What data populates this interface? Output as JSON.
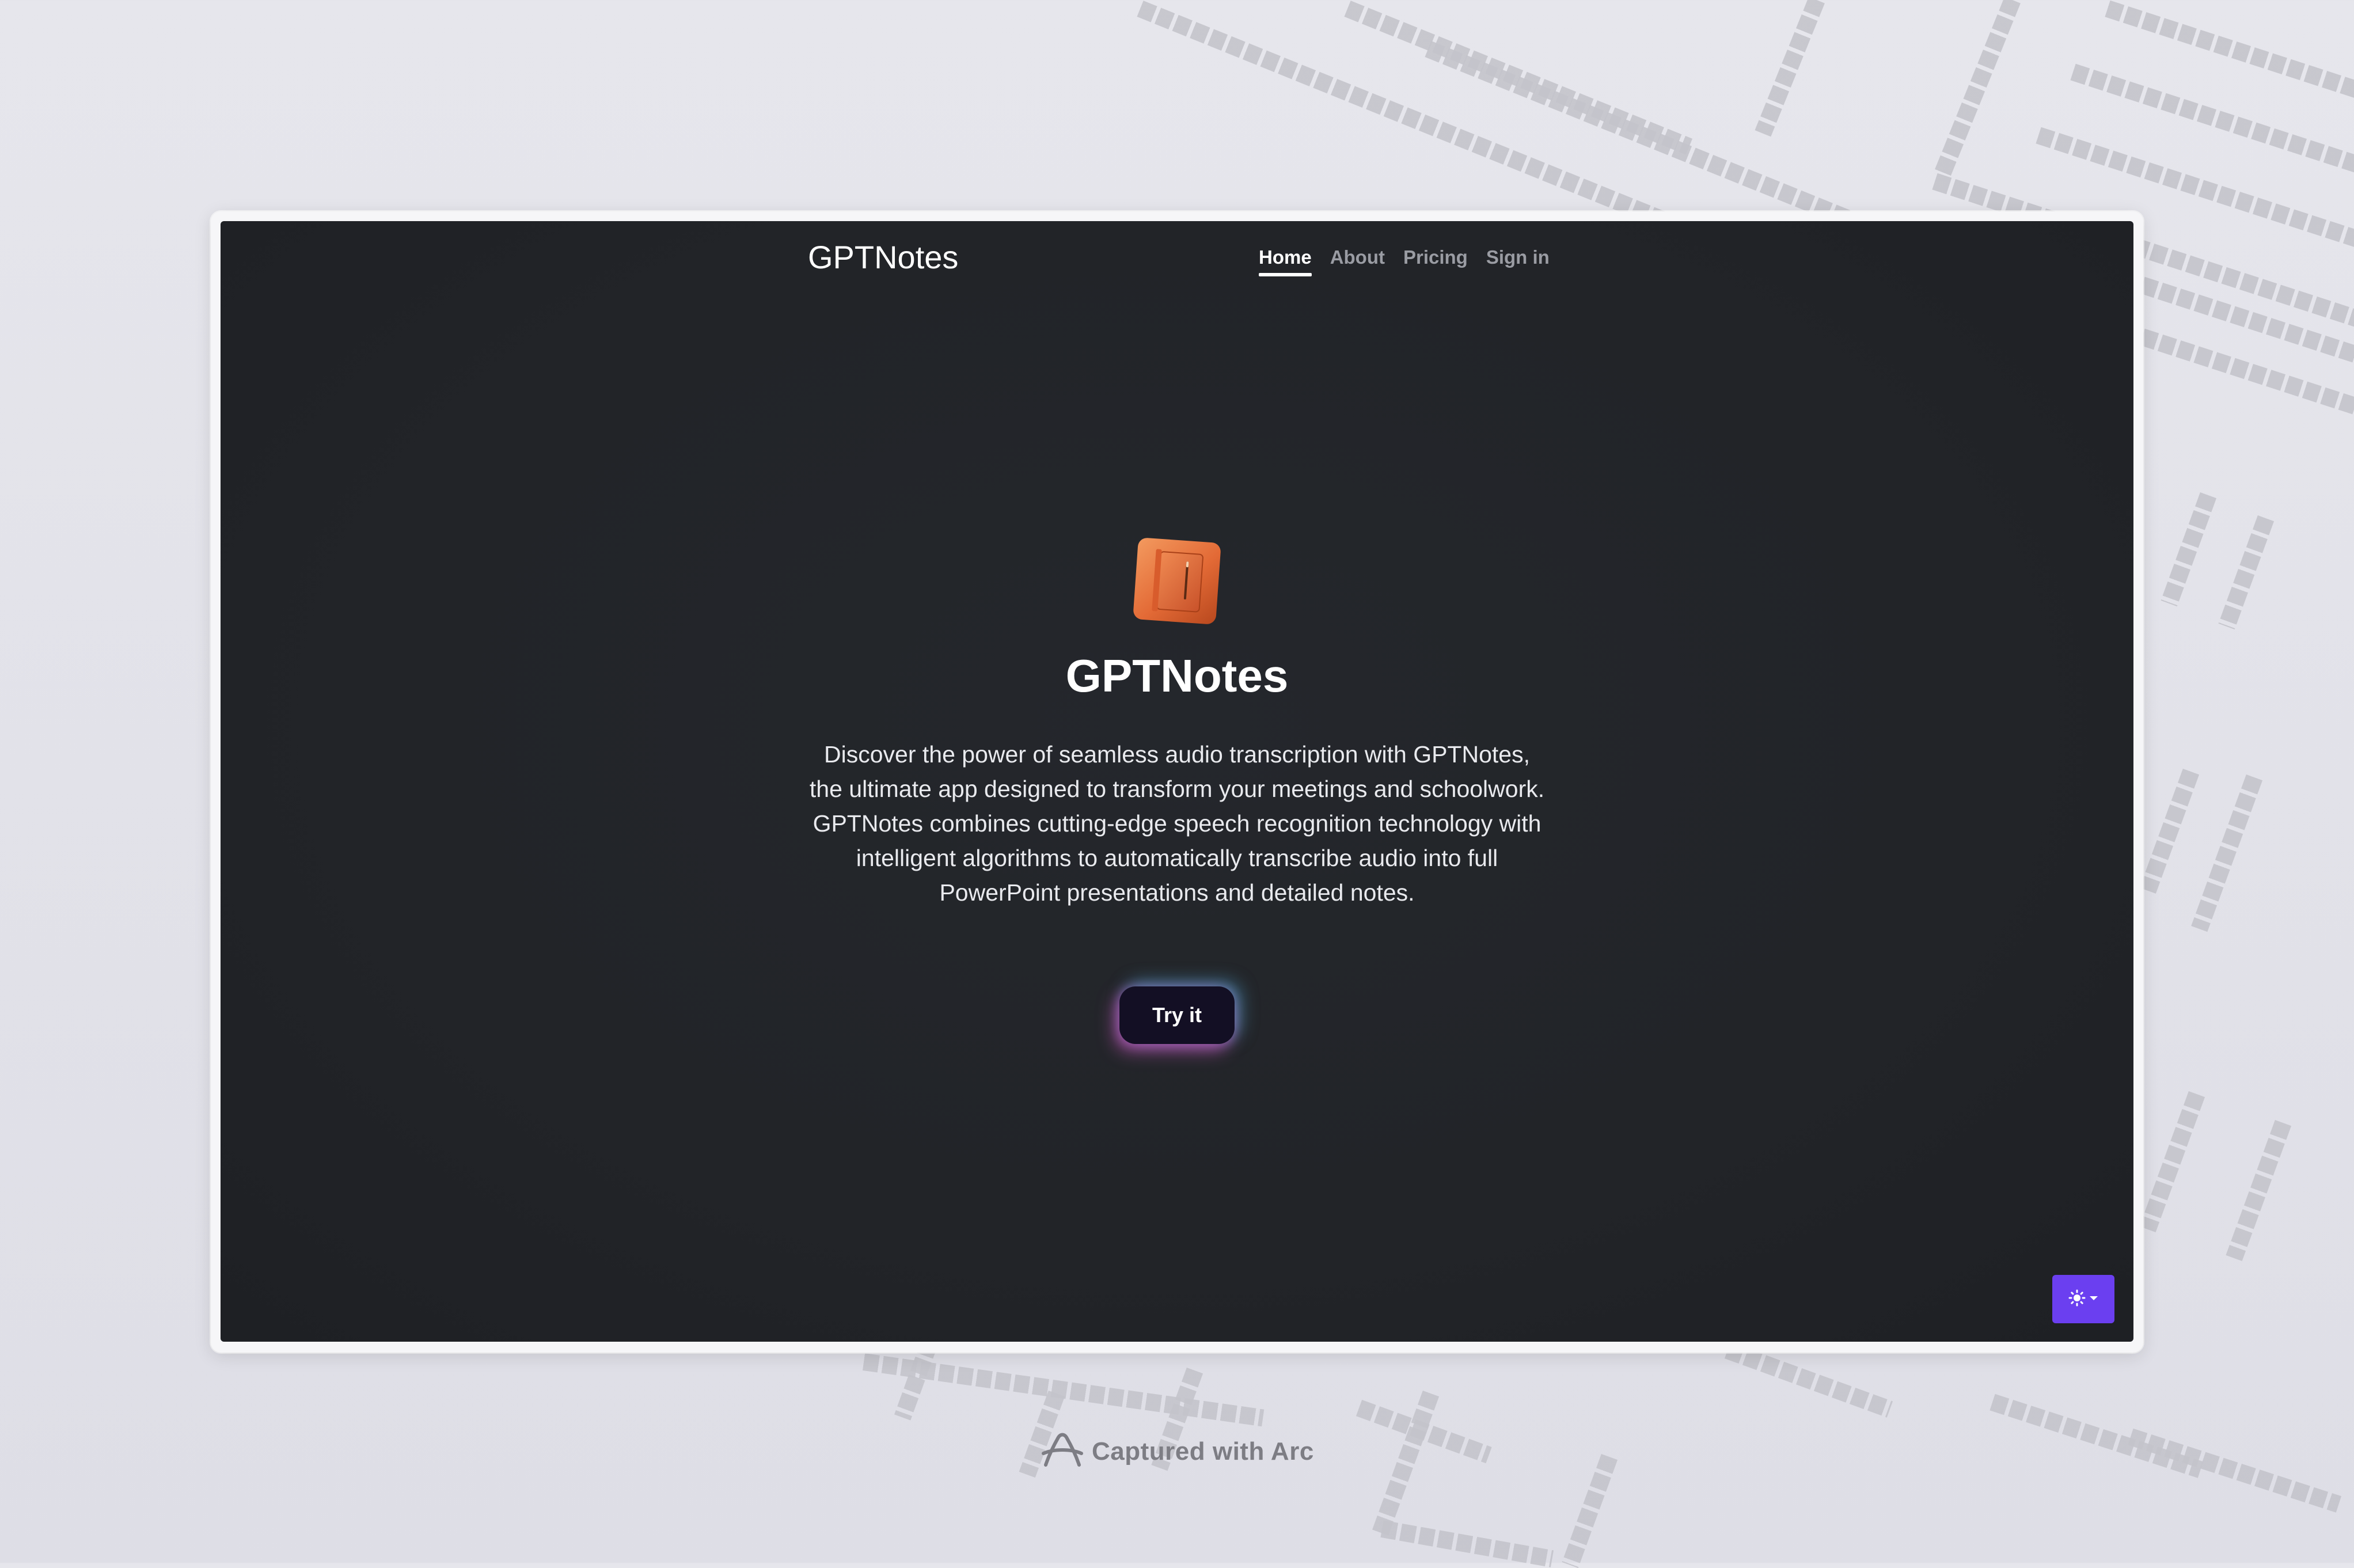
{
  "nav": {
    "brand": "GPTNotes",
    "links": [
      {
        "label": "Home",
        "active": true
      },
      {
        "label": "About",
        "active": false
      },
      {
        "label": "Pricing",
        "active": false
      },
      {
        "label": "Sign in",
        "active": false
      }
    ]
  },
  "hero": {
    "app_icon": "notebook-icon",
    "title": "GPTNotes",
    "description": "Discover the power of seamless audio transcription with GPTNotes, the ultimate app designed to transform your meetings and schoolwork. GPTNotes combines cutting-edge speech recognition technology with intelligent algorithms to automatically transcribe audio into full PowerPoint presentations and detailed notes.",
    "cta_label": "Try it"
  },
  "theme_toggle": {
    "icon": "sun-icon",
    "caret": "chevron-down-icon",
    "color": "#6b3ff0"
  },
  "footer": {
    "icon": "arc-logo-icon",
    "text": "Captured with Arc"
  },
  "colors": {
    "page_bg": "#222428",
    "accent": "#6b3ff0",
    "app_icon": "#e8713f"
  }
}
